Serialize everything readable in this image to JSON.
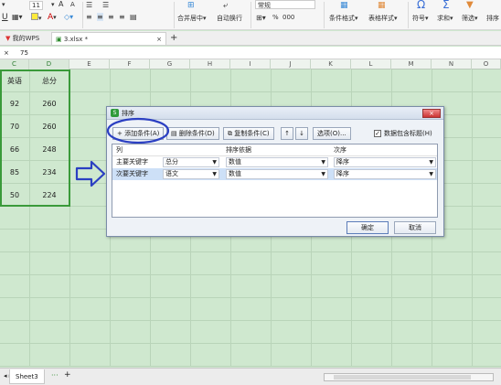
{
  "ribbon": {
    "font_size": "11",
    "font_size_up": "A",
    "font_size_down": "A",
    "underline": "U",
    "merge_center": "合并居中",
    "wrap_text": "自动换行",
    "number_format": "常规",
    "percent": "%",
    "thousands": "000",
    "conditional_format": "条件格式",
    "table_style": "表格样式",
    "symbol": "符号",
    "sum": "求和",
    "filter": "筛选",
    "sort": "排序"
  },
  "tabs": {
    "home": "我的WPS",
    "file": "3.xlsx *",
    "close": "×",
    "add": "+"
  },
  "formula_bar": {
    "close": "×",
    "value": "75"
  },
  "columns": [
    "C",
    "D",
    "E",
    "F",
    "G",
    "H",
    "I",
    "J",
    "K",
    "L",
    "M",
    "N",
    "O"
  ],
  "table": {
    "headers": [
      "英语",
      "总分"
    ],
    "rows": [
      [
        "92",
        "260"
      ],
      [
        "70",
        "260"
      ],
      [
        "66",
        "248"
      ],
      [
        "85",
        "234"
      ],
      [
        "50",
        "224"
      ]
    ]
  },
  "dialog": {
    "title": "排序",
    "close": "×",
    "add_condition": "添加条件(A)",
    "delete_condition": "删除条件(D)",
    "copy_condition": "复制条件(C)",
    "move_up": "↑",
    "move_down": "↓",
    "options": "选项(O)...",
    "header_checkbox_label": "数据包含标题(H)",
    "header_checked": "✓",
    "col_headers": {
      "column": "列",
      "sort_on": "排序依据",
      "order": "次序"
    },
    "rows": [
      {
        "label": "主要关键字",
        "column": "总分",
        "sort_on": "数值",
        "order": "降序"
      },
      {
        "label": "次要关键字",
        "column": "语文",
        "sort_on": "数值",
        "order": "降序"
      }
    ],
    "ok": "确定",
    "cancel": "取消"
  },
  "sheetbar": {
    "sheet_name": "Sheet3",
    "more": "···",
    "add": "+"
  },
  "colors": {
    "grid_bg": "#cfe8cf",
    "annotation": "#2b3fc2",
    "selection": "#3a9a3a"
  }
}
